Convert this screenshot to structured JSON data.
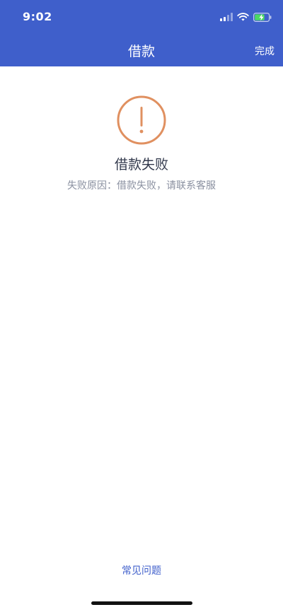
{
  "status_bar": {
    "time": "9:02"
  },
  "nav": {
    "title": "借款",
    "done_label": "完成"
  },
  "result": {
    "icon": "exclamation-circle-icon",
    "title": "借款失败",
    "reason": "失败原因：借款失败，请联系客服"
  },
  "footer": {
    "faq_label": "常见问题"
  },
  "colors": {
    "header_bg": "#3f5fcb",
    "alert_icon": "#e09060",
    "link": "#3f5fcb",
    "battery_charging": "#4cd964"
  }
}
